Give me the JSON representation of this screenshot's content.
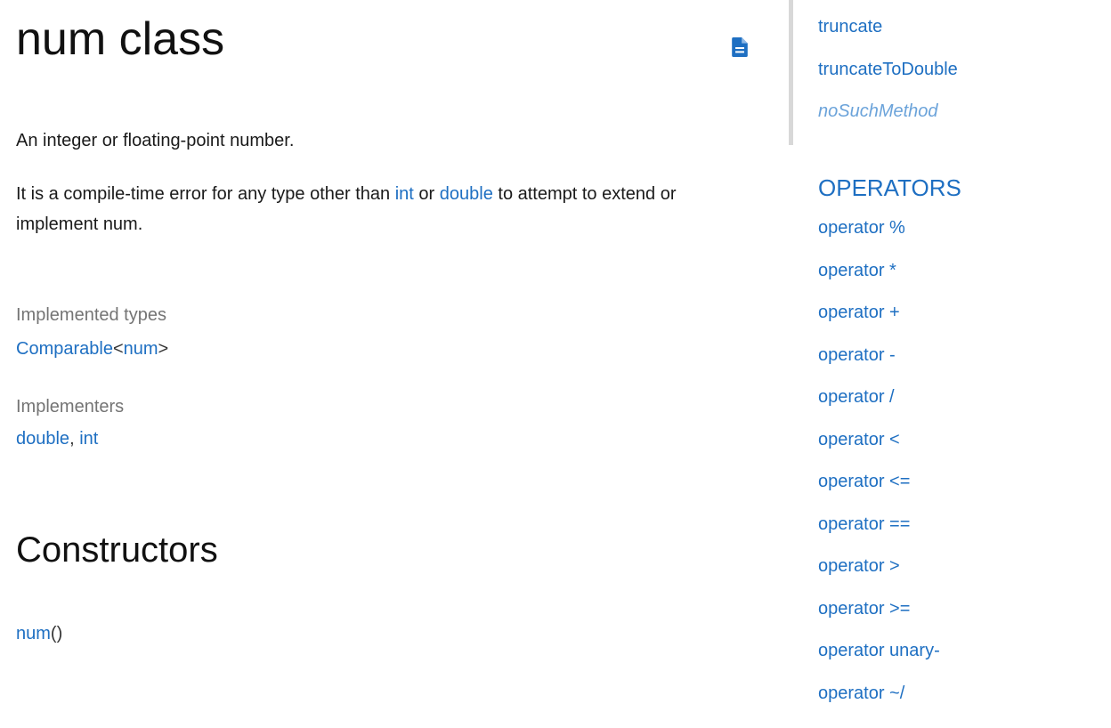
{
  "page": {
    "title": "num class",
    "source_icon": "document-icon",
    "description": {
      "p1": "An integer or floating-point number.",
      "p2_before": "It is a compile-time error for any type other than ",
      "p2_link1": "int",
      "p2_mid": " or ",
      "p2_link2": "double",
      "p2_after": " to attempt to extend or implement num."
    },
    "implemented_types": {
      "label": "Implemented types",
      "link": "Comparable",
      "lt": "<",
      "type_arg": "num",
      "gt": ">"
    },
    "implementers": {
      "label": "Implementers",
      "items": [
        "double",
        "int"
      ],
      "separator": ", "
    },
    "constructors": {
      "heading": "Constructors",
      "name": "num",
      "parens": "()"
    }
  },
  "sidebar": {
    "methods": [
      "truncate",
      "truncateToDouble",
      "noSuchMethod"
    ],
    "operators_heading": "OPERATORS",
    "operators": [
      "operator %",
      "operator *",
      "operator +",
      "operator -",
      "operator /",
      "operator <",
      "operator <=",
      "operator ==",
      "operator >",
      "operator >=",
      "operator unary-",
      "operator ~/"
    ]
  },
  "colors": {
    "link": "#1e6fc2",
    "inherited_link": "#6ba3da",
    "muted_label": "#747474"
  }
}
